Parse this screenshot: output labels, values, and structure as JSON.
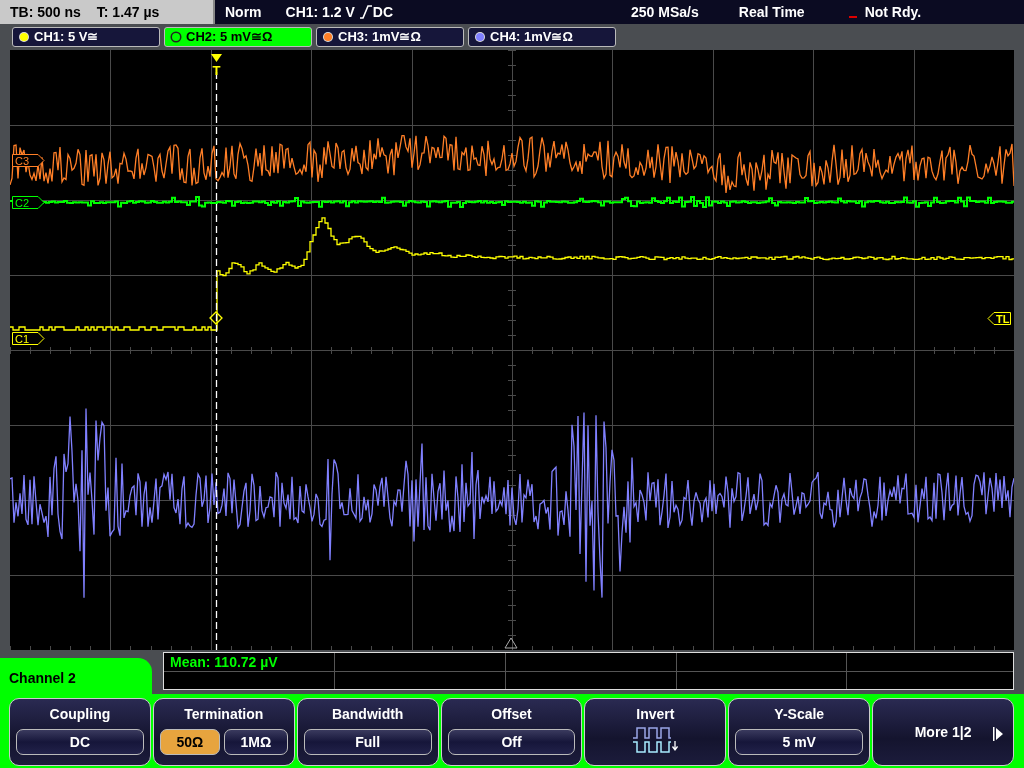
{
  "status_bar": {
    "timebase": "TB: 500 ns",
    "trigger_time": "T: 1.47 µs",
    "mode": "Norm",
    "trigger_source": "CH1: 1.2 V",
    "trigger_coupling": "DC",
    "sample_rate": "250 MSa/s",
    "acquisition": "Real Time",
    "state": "Not Rdy."
  },
  "channels": [
    {
      "label": "CH1: 5 V≅",
      "color": "#ffff00",
      "selected": false
    },
    {
      "label": "CH2: 5 mV≅Ω",
      "color": "#00ff00",
      "selected": true
    },
    {
      "label": "CH3: 1mV≅Ω",
      "color": "#ff7f27",
      "selected": false
    },
    {
      "label": "CH4: 1mV≅Ω",
      "color": "#8080ff",
      "selected": false
    }
  ],
  "plot": {
    "trigger_marker": "T",
    "trigger_level_marker": "TL",
    "markers": [
      {
        "label": "C3",
        "color": "#ff7f27"
      },
      {
        "label": "C2",
        "color": "#00ff00"
      },
      {
        "label": "C1",
        "color": "#ffff00"
      }
    ]
  },
  "measurement": {
    "text": "Mean: 110.72 µV"
  },
  "menu": {
    "title": "Channel 2",
    "softkeys": [
      {
        "kind": "value",
        "label": "Coupling",
        "value": "DC"
      },
      {
        "kind": "choice",
        "label": "Termination",
        "options": [
          {
            "label": "50Ω",
            "selected": true
          },
          {
            "label": "1MΩ",
            "selected": false
          }
        ]
      },
      {
        "kind": "value",
        "label": "Bandwidth",
        "value": "Full"
      },
      {
        "kind": "value",
        "label": "Offset",
        "value": "Off"
      },
      {
        "kind": "icon",
        "label": "Invert"
      },
      {
        "kind": "value",
        "label": "Y-Scale",
        "value": "5 mV"
      },
      {
        "kind": "more",
        "label": "More 1|2"
      }
    ]
  }
}
